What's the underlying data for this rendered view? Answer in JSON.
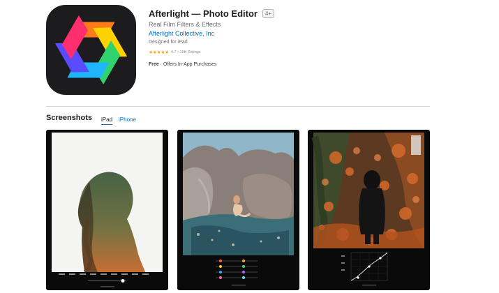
{
  "app": {
    "title": "Afterlight — Photo Editor",
    "age_rating": "4+",
    "subtitle": "Real Film Filters & Effects",
    "developer": "Afterlight Collective, Inc",
    "designed_for": "Designed for iPad",
    "rating_stars": "★★★★★",
    "rating_text": "4.7 • 19K Ratings",
    "price": "Free",
    "iap_text": " · Offers In-App Purchases"
  },
  "screenshots": {
    "heading": "Screenshots",
    "tabs": [
      {
        "label": "iPad",
        "selected": true
      },
      {
        "label": "iPhone",
        "selected": false
      }
    ],
    "items": [
      {
        "name": "double-exposure-portrait"
      },
      {
        "name": "rock-portrait"
      },
      {
        "name": "autumn-forest-curves"
      }
    ]
  },
  "colors": {
    "link": "#0070c9",
    "star": "#f5a623",
    "icon_bg": "#1c1c1e",
    "divider": "#d2d2d7"
  }
}
